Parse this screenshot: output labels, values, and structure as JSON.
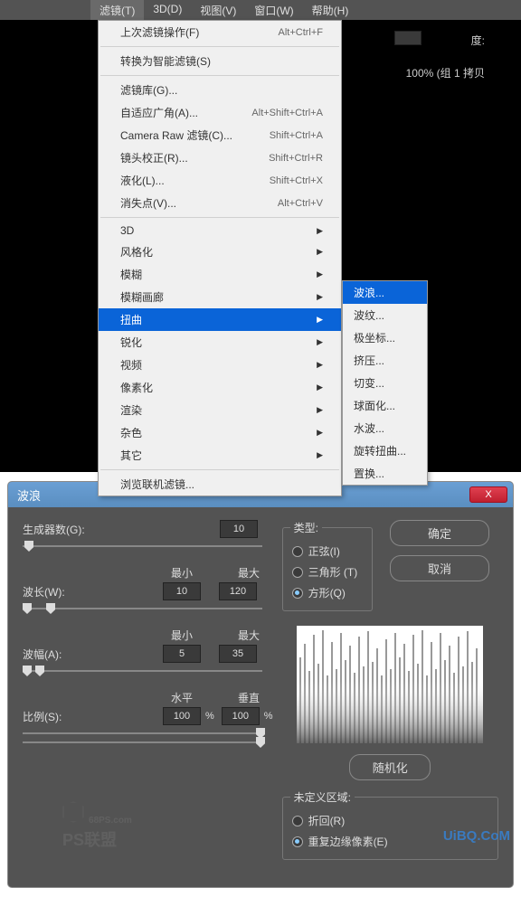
{
  "menubar": [
    {
      "label": "滤镜(T)",
      "active": true
    },
    {
      "label": "3D(D)"
    },
    {
      "label": "视图(V)"
    },
    {
      "label": "窗口(W)"
    },
    {
      "label": "帮助(H)"
    }
  ],
  "bg": {
    "label1": "度:",
    "label2": "100% (组 1 拷贝"
  },
  "menu": {
    "last": {
      "label": "上次滤镜操作(F)",
      "shortcut": "Alt+Ctrl+F"
    },
    "smart": {
      "label": "转换为智能滤镜(S)"
    },
    "lib": {
      "label": "滤镜库(G)..."
    },
    "wide": {
      "label": "自适应广角(A)...",
      "shortcut": "Alt+Shift+Ctrl+A"
    },
    "craw": {
      "label": "Camera Raw 滤镜(C)...",
      "shortcut": "Shift+Ctrl+A"
    },
    "lens": {
      "label": "镜头校正(R)...",
      "shortcut": "Shift+Ctrl+R"
    },
    "liq": {
      "label": "液化(L)...",
      "shortcut": "Shift+Ctrl+X"
    },
    "van": {
      "label": "消失点(V)...",
      "shortcut": "Alt+Ctrl+V"
    },
    "g3d": {
      "label": "3D"
    },
    "style": {
      "label": "风格化"
    },
    "blur": {
      "label": "模糊"
    },
    "blurg": {
      "label": "模糊画廊"
    },
    "distort": {
      "label": "扭曲"
    },
    "sharp": {
      "label": "锐化"
    },
    "video": {
      "label": "视频"
    },
    "pixel": {
      "label": "像素化"
    },
    "render": {
      "label": "渲染"
    },
    "noise": {
      "label": "杂色"
    },
    "other": {
      "label": "其它"
    },
    "browse": {
      "label": "浏览联机滤镜..."
    }
  },
  "submenu": {
    "wave": "波浪...",
    "ripple": "波纹...",
    "polar": "极坐标...",
    "pinch": "挤压...",
    "shear": "切变...",
    "sphere": "球面化...",
    "zigzag": "水波...",
    "twirl": "旋转扭曲...",
    "displace": "置换..."
  },
  "dialog": {
    "title": "波浪",
    "ok": "确定",
    "cancel": "取消",
    "randomize": "随机化",
    "close": "X",
    "gen": {
      "label": "生成器数(G):",
      "value": "10"
    },
    "wl": {
      "label": "波长(W):",
      "minlabel": "最小",
      "maxlabel": "最大",
      "min": "10",
      "max": "120"
    },
    "amp": {
      "label": "波幅(A):",
      "minlabel": "最小",
      "maxlabel": "最大",
      "min": "5",
      "max": "35"
    },
    "scale": {
      "label": "比例(S):",
      "hlabel": "水平",
      "vlabel": "垂直",
      "h": "100",
      "v": "100"
    },
    "type": {
      "legend": "类型:",
      "sine": "正弦(I)",
      "tri": "三角形 (T)",
      "square": "方形(Q)"
    },
    "undef": {
      "legend": "未定义区域:",
      "wrap": "折回(R)",
      "repeat": "重复边缘像素(E)"
    }
  },
  "watermark": {
    "t1": "68PS.com",
    "t2": "PS联盟",
    "t3": "UiBQ.CoM"
  }
}
